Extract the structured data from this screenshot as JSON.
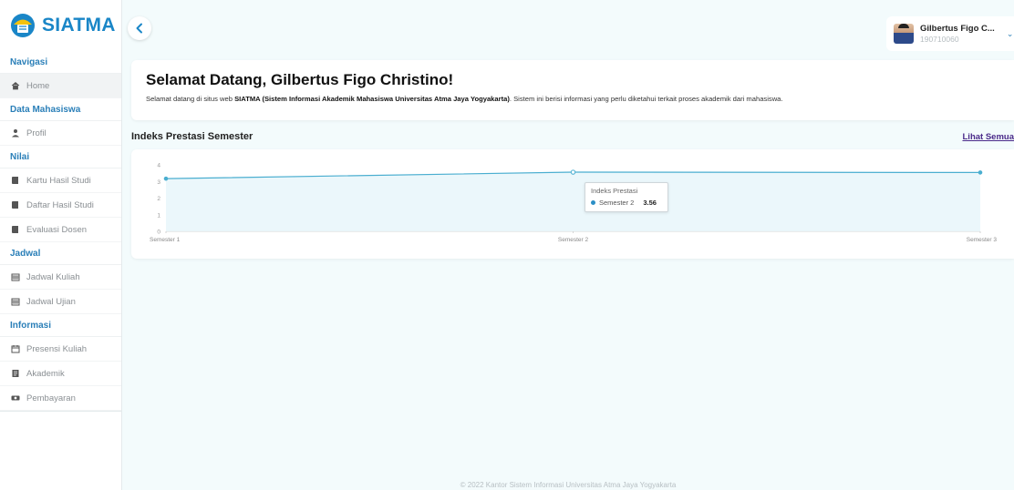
{
  "app": {
    "name": "SIATMA"
  },
  "sidebar": {
    "sections": [
      {
        "title": "Navigasi",
        "items": [
          {
            "label": "Home",
            "icon": "home-icon"
          }
        ]
      },
      {
        "title": "Data Mahasiswa",
        "items": [
          {
            "label": "Profil",
            "icon": "user-icon"
          }
        ]
      },
      {
        "title": "Nilai",
        "items": [
          {
            "label": "Kartu Hasil Studi",
            "icon": "book-icon"
          },
          {
            "label": "Daftar Hasil Studi",
            "icon": "book-icon"
          },
          {
            "label": "Evaluasi Dosen",
            "icon": "book-icon"
          }
        ]
      },
      {
        "title": "Jadwal",
        "items": [
          {
            "label": "Jadwal Kuliah",
            "icon": "calendar-icon"
          },
          {
            "label": "Jadwal Ujian",
            "icon": "calendar-icon"
          }
        ]
      },
      {
        "title": "Informasi",
        "items": [
          {
            "label": "Presensi Kuliah",
            "icon": "calendar-outline-icon"
          },
          {
            "label": "Akademik",
            "icon": "document-icon"
          },
          {
            "label": "Pembayaran",
            "icon": "money-icon"
          }
        ]
      }
    ]
  },
  "user": {
    "name": "Gilbertus Figo C...",
    "id": "190710060"
  },
  "welcome": {
    "title": "Selamat Datang, Gilbertus Figo Christino!",
    "desc_before": "Selamat datang di situs web ",
    "desc_bold": "SIATMA (Sistem Informasi Akademik Mahasiswa Universitas Atma Jaya Yogyakarta)",
    "desc_after": ". Sistem ini berisi informasi yang perlu diketahui terkait proses akademik dari mahasiswa."
  },
  "ip": {
    "title": "Indeks Prestasi Semester",
    "link": "Lihat Semua"
  },
  "chart_data": {
    "type": "area",
    "categories": [
      "Semester 1",
      "Semester 2",
      "Semester 3"
    ],
    "series": [
      {
        "name": "Indeks Prestasi",
        "values": [
          3.17,
          3.56,
          3.54
        ]
      }
    ],
    "ylim": [
      0,
      4
    ],
    "yticks": [
      0,
      1,
      2,
      3,
      4
    ],
    "grid": false,
    "colors": {
      "line": "#4aaed0",
      "fill": "#e6f5fa"
    },
    "tooltip": {
      "title": "Indeks Prestasi",
      "label": "Semester 2",
      "value": "3.56"
    }
  },
  "footer": "© 2022 Kantor Sistem Informasi Universitas Atma Jaya Yogyakarta"
}
